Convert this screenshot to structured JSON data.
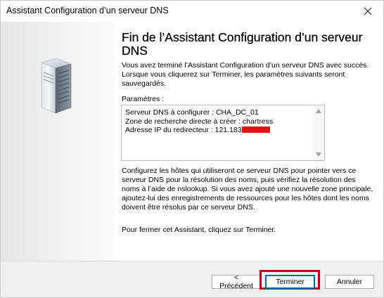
{
  "window": {
    "title": "Assistant Configuration d’un serveur DNS"
  },
  "icons": {
    "close": "close-icon",
    "server": "server-icon",
    "scroll_up": "scroll-up-arrow-icon",
    "scroll_down": "scroll-down-arrow-icon"
  },
  "main": {
    "heading": "Fin de l’Assistant Configuration d’un serveur DNS",
    "intro": "Vous avez terminé l’Assistant Configuration d’un serveur DNS avec succès. Lorsque vous cliquerez sur Terminer, les paramètres suivants seront sauvegardés.",
    "params_label": "Paramètres :",
    "params": {
      "line1": "Serveur DNS à configurer : CHA_DC_01",
      "line2": "Zone de recherche directe à créer : chartress",
      "line3": "Adresse IP du redirecteur : 121.183"
    },
    "body": "Configurez les hôtes qui utiliseront ce serveur DNS pour pointer vers ce serveur DNS pour la résolution des noms, puis vérifiez la résolution des noms à l’aide de nslookup. Si vous avez ajouté une nouvelle zone principale, ajoutez-lui des enregistrements de ressources pour les hôtes dont les noms doivent être résolus par ce serveur DNS.",
    "closing": "Pour fermer cet Assistant, cliquez sur Terminer."
  },
  "footer": {
    "prev_label": "< Précédent",
    "finish_label": "Terminer",
    "cancel_label": "Annuler"
  },
  "colors": {
    "highlight": "#c0001a",
    "redaction": "#e31414",
    "default_button_border": "#0067c0"
  }
}
